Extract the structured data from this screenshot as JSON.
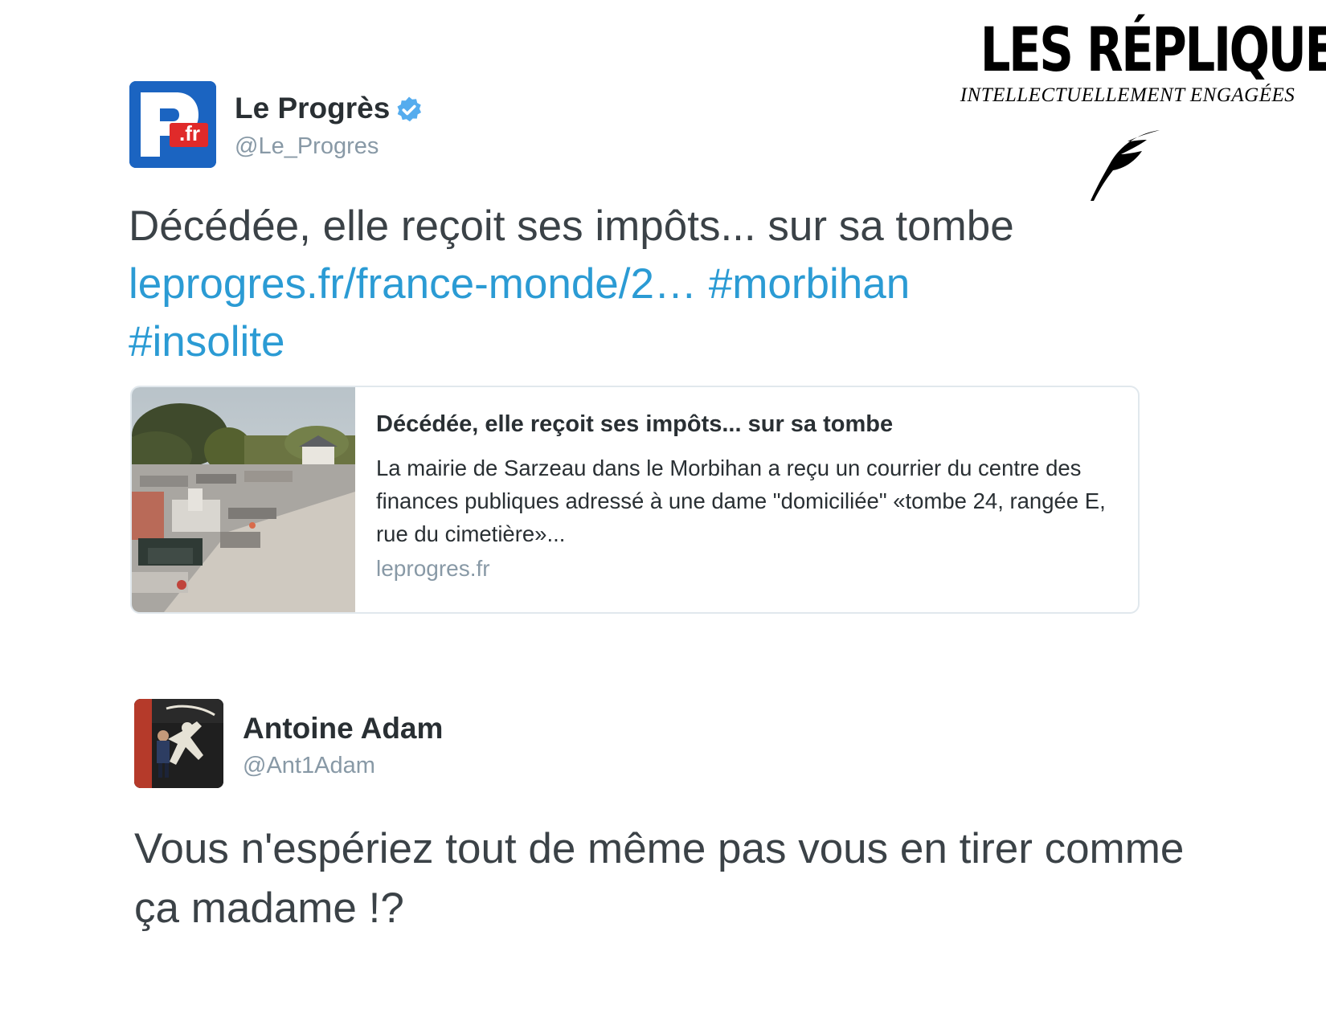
{
  "brand": {
    "title": "LES RÉPLIQUES",
    "subtitle": "INTELLECTUELLEMENT ENGAGÉES",
    "icon": "feather-quill-icon"
  },
  "tweet1": {
    "avatar": {
      "icon": "le-progres-logo",
      "text": ".fr"
    },
    "name": "Le Progrès",
    "verified_icon": "verified-badge-icon",
    "handle": "@Le_Progres",
    "text": "Décédée, elle reçoit ses impôts... sur sa tombe",
    "link": "leprogres.fr/france-monde/2…",
    "hashtags": [
      "#morbihan",
      "#insolite"
    ],
    "card": {
      "title": "Décédée, elle reçoit ses impôts... sur sa tombe",
      "description": "La mairie de Sarzeau dans le Morbihan a reçu un courrier du centre des finances publiques adressé à une dame \"domiciliée\" «tombe 24, rangée E, rue du cimetière»...",
      "domain": "leprogres.fr",
      "image": "cemetery-photo"
    }
  },
  "tweet2": {
    "avatar": "user-avatar-photo",
    "name": "Antoine Adam",
    "handle": "@Ant1Adam",
    "text": "Vous n'espériez tout de même pas vous en tirer comme ça madame !?"
  },
  "colors": {
    "link": "#2b9bd4",
    "text": "#3b4247",
    "handle": "#8899a6",
    "verified": "#55acee",
    "brand_blue": "#1b64c1",
    "brand_red": "#e02a2a"
  }
}
